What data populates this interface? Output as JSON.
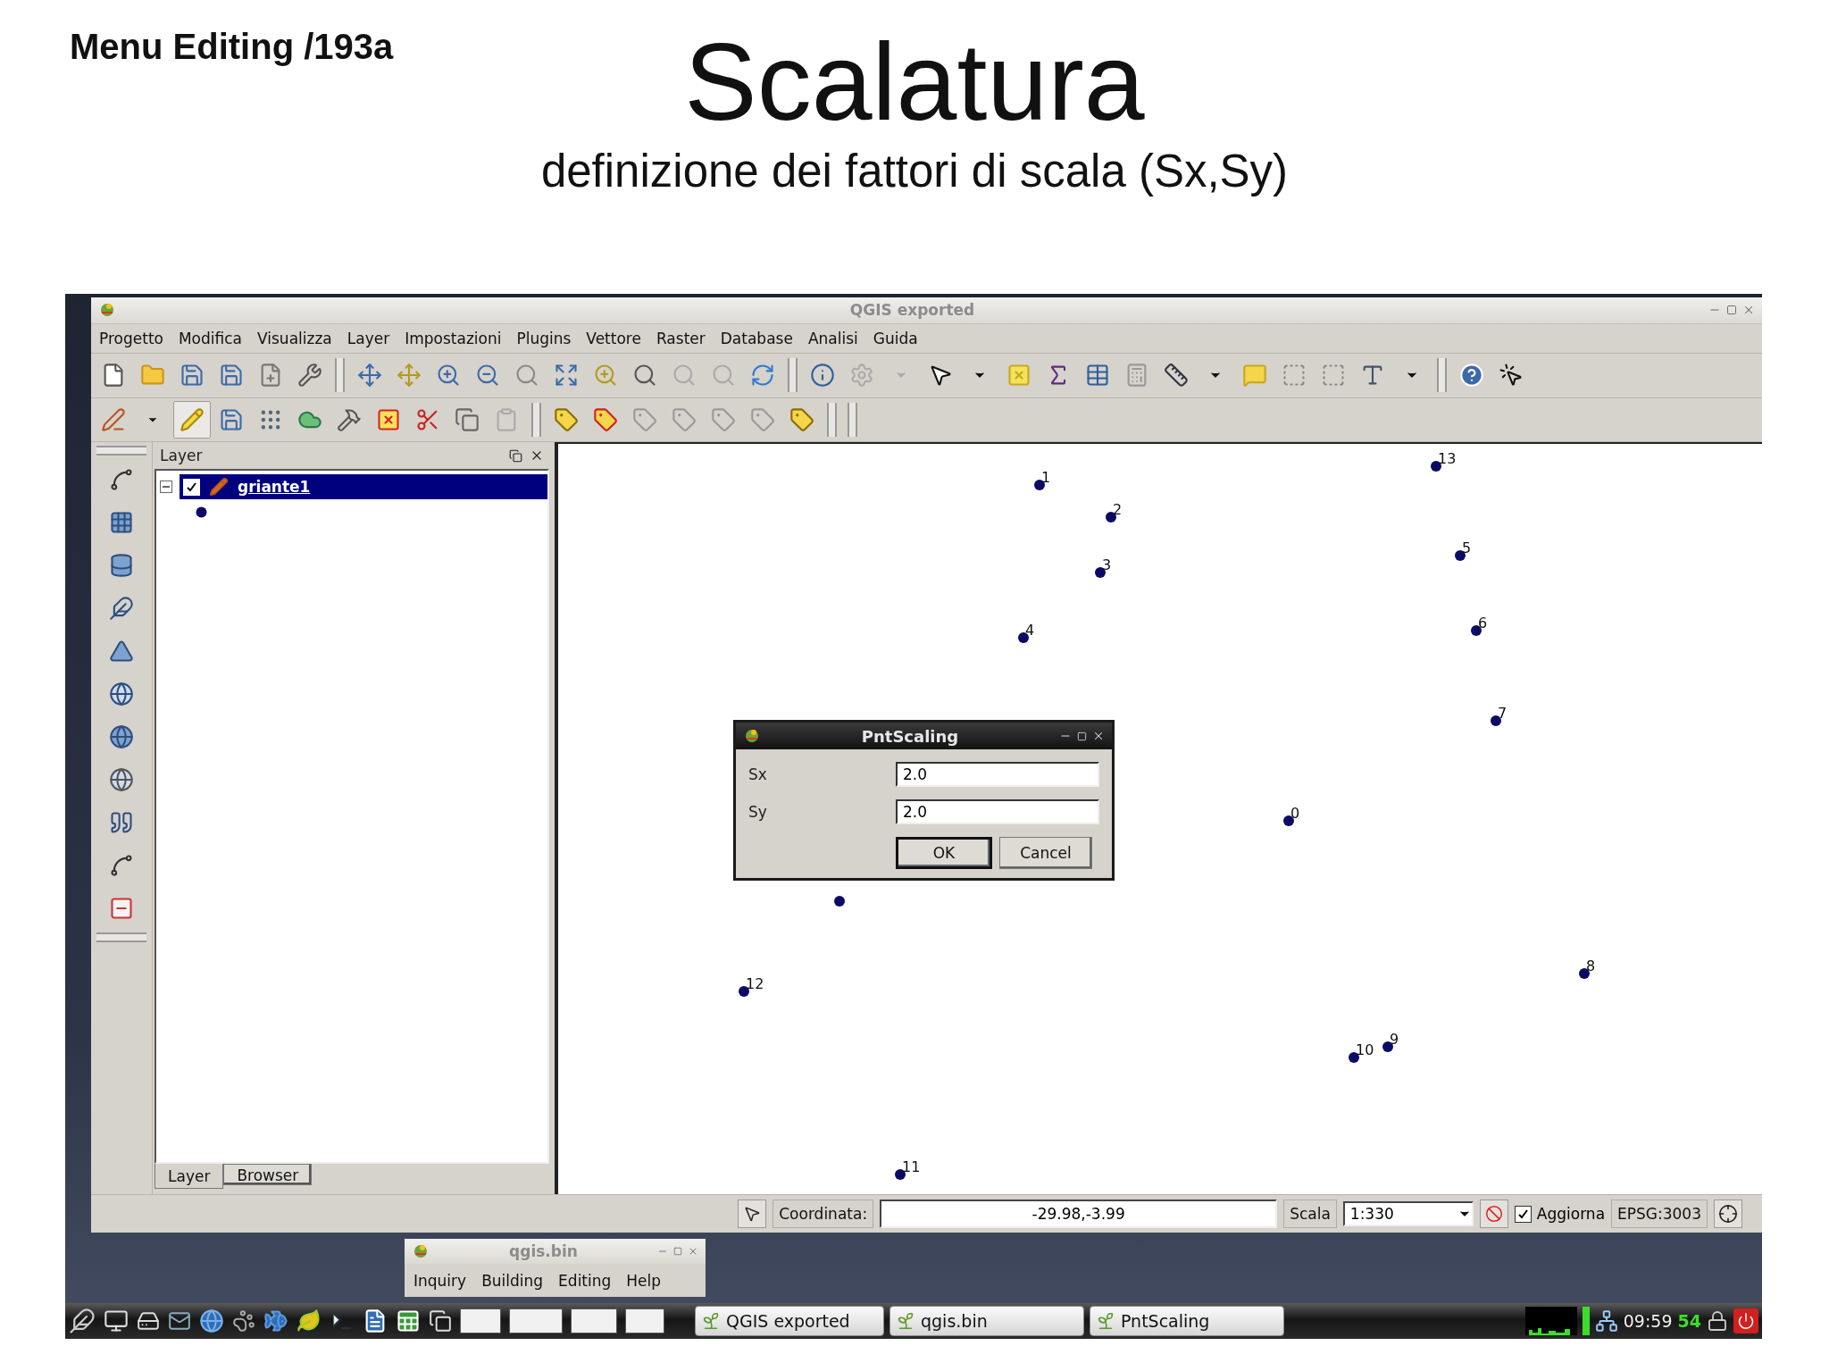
{
  "slide": {
    "header": "Menu Editing /193a",
    "title": "Scalatura",
    "subtitle": "definizione dei fattori di scala (Sx,Sy)"
  },
  "window": {
    "title": "QGIS exported"
  },
  "menu": [
    "Progetto",
    "Modifica",
    "Visualizza",
    "Layer",
    "Impostazioni",
    "Plugins",
    "Vettore",
    "Raster",
    "Database",
    "Analisi",
    "Guida"
  ],
  "layer_panel": {
    "title": "Layer",
    "layers": [
      {
        "name": "griante1",
        "checked": true,
        "selected": true
      }
    ],
    "tabs": [
      {
        "label": "Layer",
        "selected": true
      },
      {
        "label": "Browser",
        "selected": false
      }
    ]
  },
  "map_points": [
    {
      "kind": "labeled",
      "label": "13"
    },
    {
      "kind": "labeled",
      "label": "1"
    },
    {
      "kind": "labeled",
      "label": "2"
    },
    {
      "kind": "labeled",
      "label": "5"
    },
    {
      "kind": "labeled",
      "label": "3"
    },
    {
      "kind": "labeled",
      "label": "4"
    },
    {
      "kind": "labeled",
      "label": "6"
    },
    {
      "kind": "labeled",
      "label": "7"
    },
    {
      "kind": "labeled",
      "label": "0"
    },
    {
      "kind": "unlabeled"
    },
    {
      "kind": "labeled",
      "label": "8"
    },
    {
      "kind": "labeled",
      "label": "12"
    },
    {
      "kind": "labeled",
      "label": "10"
    },
    {
      "kind": "labeled",
      "label": "9"
    },
    {
      "kind": "labeled",
      "label": "11"
    }
  ],
  "dialog": {
    "title": "PntScaling",
    "fields": [
      {
        "label": "Sx",
        "value": "2.0"
      },
      {
        "label": "Sy",
        "value": "2.0"
      }
    ],
    "buttons": [
      {
        "label": "OK",
        "default": true
      },
      {
        "label": "Cancel",
        "default": false
      }
    ]
  },
  "status_bar": {
    "coord_label": "Coordinata:",
    "coord_value": "-29.98,-3.99",
    "scale_label": "Scala",
    "scale_value": "1:330",
    "render_label": "Aggiorna",
    "render_checked": true,
    "crs": "EPSG:3003"
  },
  "small_window": {
    "title": "qgis.bin",
    "menu": [
      "Inquiry",
      "Building",
      "Editing",
      "Help"
    ]
  },
  "taskbar": {
    "tasks": [
      {
        "label": "QGIS exported"
      },
      {
        "label": "qgis.bin"
      },
      {
        "label": "PntScaling"
      }
    ],
    "clock": "09:59",
    "indicator": "54"
  }
}
